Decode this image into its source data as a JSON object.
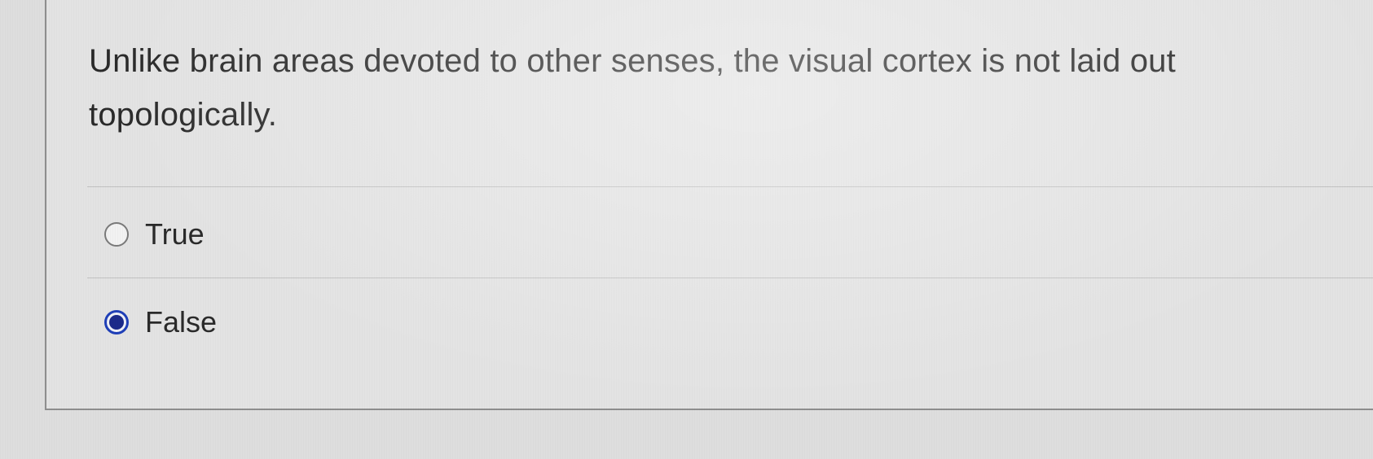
{
  "question": {
    "text": "Unlike brain areas devoted to other senses, the visual cortex is not laid out topologically."
  },
  "options": [
    {
      "label": "True",
      "selected": false
    },
    {
      "label": "False",
      "selected": true
    }
  ],
  "colors": {
    "selected_radio": "#1b2a8a",
    "background": "#dedede"
  }
}
